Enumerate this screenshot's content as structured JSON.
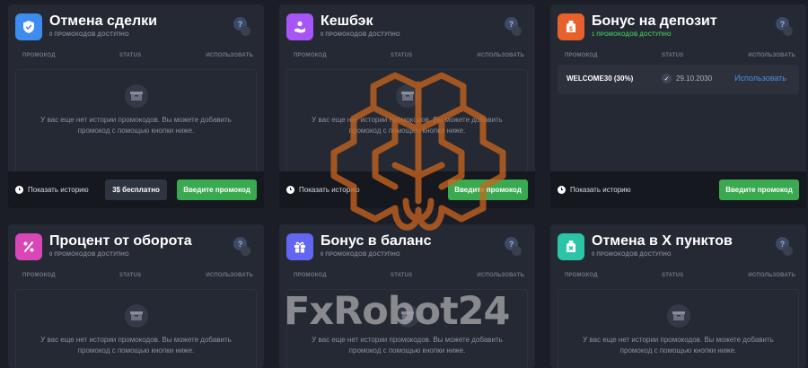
{
  "columns": {
    "promo": "ПРОМОКОД",
    "status": "STATUS",
    "use": "ИСПОЛЬЗОВАТЬ"
  },
  "empty_message": "У вас еще нет истории промокодов. Вы можете добавить промокод с помощью кнопки ниже.",
  "footer": {
    "history_label": "Показать историю",
    "enter_label": "Введите промокод",
    "bonus_label": "3$ бесплатно"
  },
  "cards": [
    {
      "title": "Отмена сделки",
      "subtitle": "0 ПРОМОКОДОВ ДОСТУПНО",
      "icon": "shield-icon",
      "color": "#3d8cf0"
    },
    {
      "title": "Кешбэк",
      "subtitle": "0 ПРОМОКОДОВ ДОСТУПНО",
      "icon": "cashback-icon",
      "color": "#a855f7"
    },
    {
      "title": "Бонус на депозит",
      "subtitle": "1 ПРОМОКОДОВ ДОСТУПНО",
      "icon": "deposit-bag-icon",
      "color": "#e8612c"
    },
    {
      "title": "Процент от оборота",
      "subtitle": "0 ПРОМОКОДОВ ДОСТУПНО",
      "icon": "percent-icon",
      "color": "#d946b8"
    },
    {
      "title": "Бонус в баланс",
      "subtitle": "0 ПРОМОКОДОВ ДОСТУПНО",
      "icon": "gift-icon",
      "color": "#6366f1"
    },
    {
      "title": "Отмена в X пунктов",
      "subtitle": "0 ПРОМОКОДОВ ДОСТУПНО",
      "icon": "cancel-x-icon",
      "color": "#2bc4a6"
    }
  ],
  "promo": {
    "code": "WELCOME30 (30%)",
    "date": "29.10.2030",
    "use_label": "Использовать"
  },
  "watermark": "FxRobot24"
}
